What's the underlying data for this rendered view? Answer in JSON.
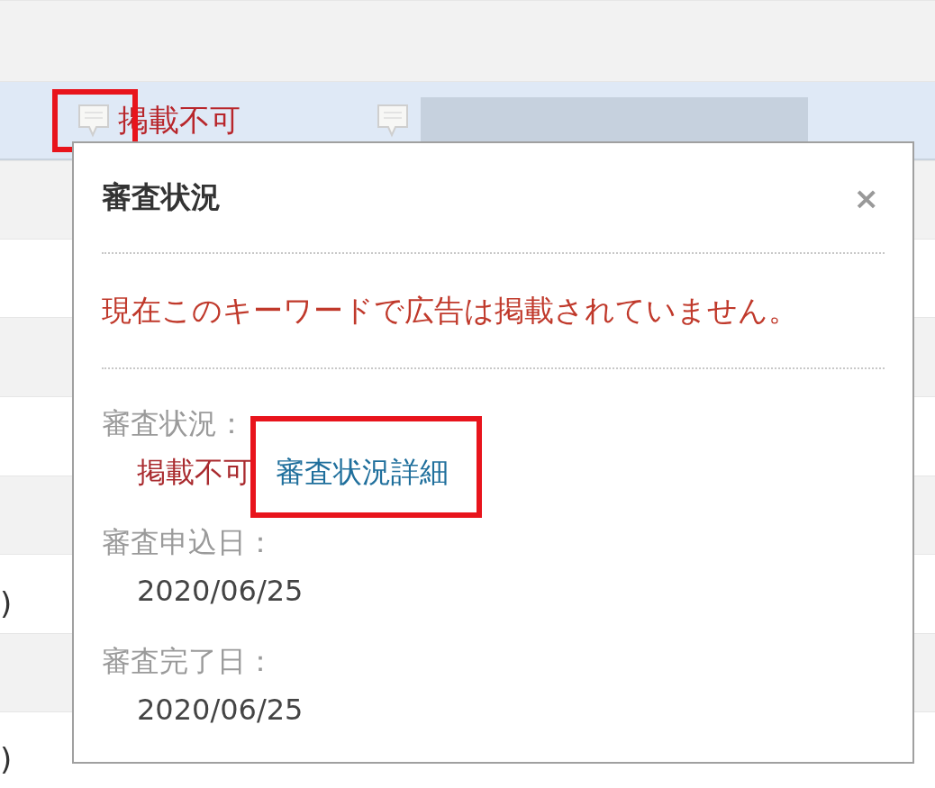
{
  "rows": [
    {
      "selected": false
    },
    {
      "selected": true,
      "status": "掲載不可",
      "status_highlighted": true,
      "redacted": true
    },
    {
      "selected": false
    },
    {
      "selected": false
    },
    {
      "selected": false
    },
    {
      "selected": false
    },
    {
      "selected": false
    },
    {
      "selected": false,
      "cell_1": ")"
    },
    {
      "selected": false
    },
    {
      "selected": false,
      "cell_1": ")"
    }
  ],
  "popup": {
    "title": "審査状況",
    "close": "×",
    "message": "現在このキーワードで広告は掲載されていません。",
    "fields": [
      {
        "kind": "status",
        "label": "審査状況：",
        "value": "掲載不可",
        "link": "審査状況詳細",
        "link_highlighted": true
      },
      {
        "kind": "date",
        "label": "審査申込日：",
        "value": "2020/06/25"
      },
      {
        "kind": "date",
        "label": "審査完了日：",
        "value": "2020/06/25"
      }
    ]
  }
}
